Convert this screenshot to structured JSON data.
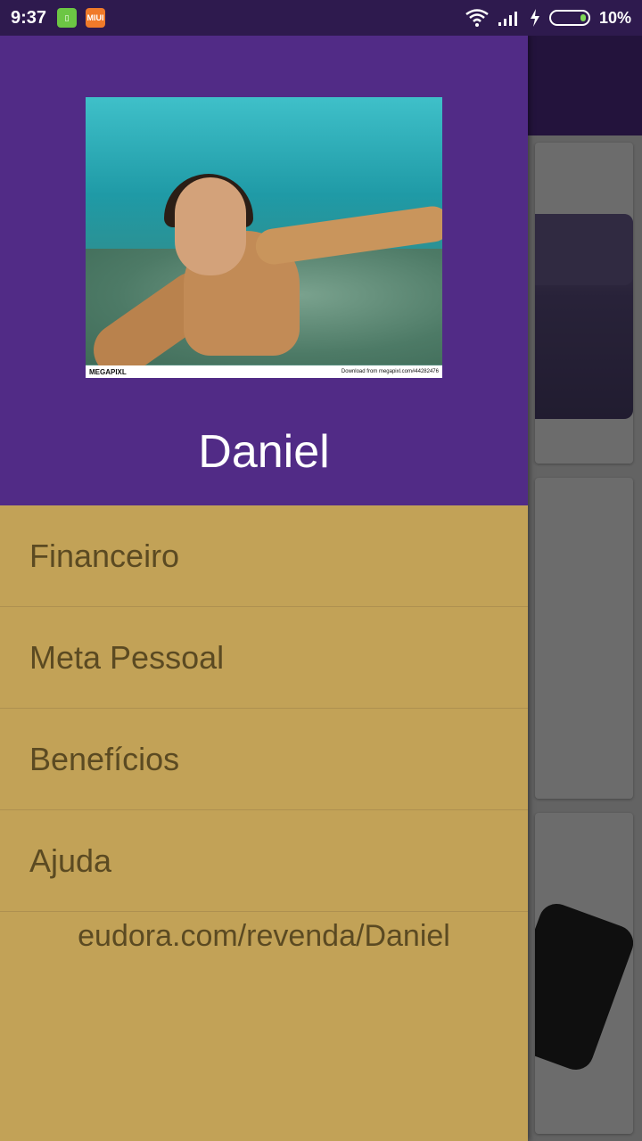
{
  "status_bar": {
    "time": "9:37",
    "notif_icons": [
      "battery-saver-icon",
      "miui-icon"
    ],
    "miui_label": "MIUI",
    "battery_percent": "10%",
    "battery_level": 0.1,
    "right_icons": [
      "wifi-icon",
      "signal-icon",
      "charging-icon",
      "battery-icon"
    ]
  },
  "drawer": {
    "user_name": "Daniel",
    "photo_watermark": {
      "logo": "MEGAPIXL",
      "download_text": "Download from megapixl.com#44282476"
    },
    "menu_items": [
      {
        "label": "Financeiro"
      },
      {
        "label": "Meta Pessoal"
      },
      {
        "label": "Benefícios"
      },
      {
        "label": "Ajuda"
      }
    ],
    "store_link": "eudora.com/revenda/Daniel"
  },
  "colors": {
    "drawer_header": "#512b86",
    "drawer_body": "#c2a257",
    "menu_text": "#5b4a22",
    "status_bar": "#2e1a4e"
  }
}
